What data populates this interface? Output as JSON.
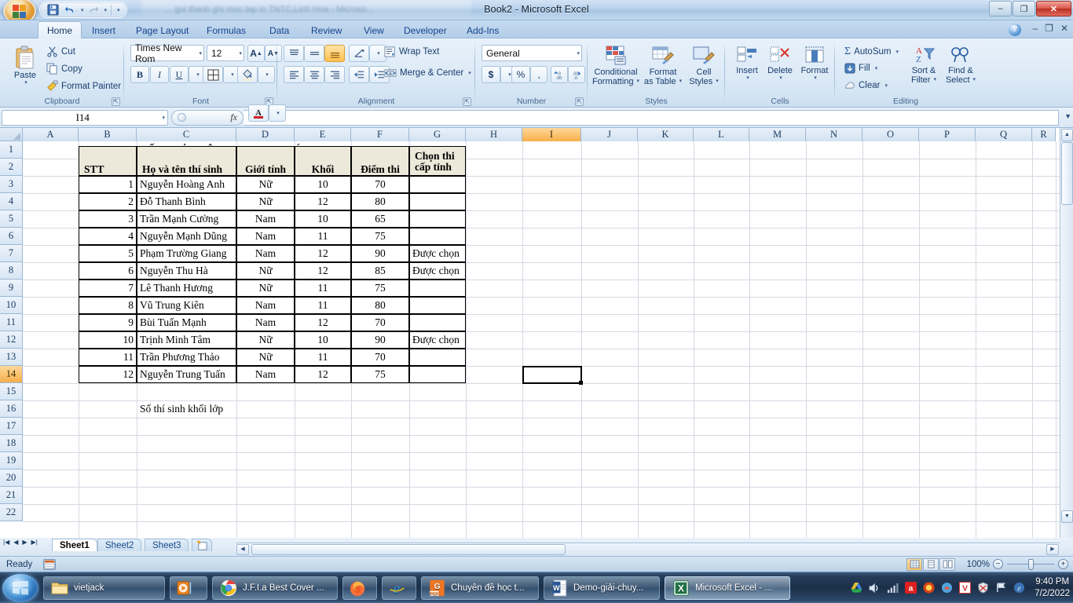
{
  "window": {
    "title": "Book2 - Microsoft Excel",
    "ghost_title": "... gui thanh ghi muc tap in TNTC,Linh Hoa - Microso...",
    "minimize": "–",
    "restore": "❐",
    "close": "✕",
    "help": "?",
    "ribbon_minimize": "–",
    "ribbon_restore": "❐",
    "ribbon_close": "✕"
  },
  "quick_access": {
    "save": "save-icon",
    "undo": "undo-icon",
    "redo": "redo-icon",
    "customize": "customize-icon"
  },
  "tabs": [
    {
      "label": "Home",
      "active": true
    },
    {
      "label": "Insert",
      "active": false
    },
    {
      "label": "Page Layout",
      "active": false
    },
    {
      "label": "Formulas",
      "active": false
    },
    {
      "label": "Data",
      "active": false
    },
    {
      "label": "Review",
      "active": false
    },
    {
      "label": "View",
      "active": false
    },
    {
      "label": "Developer",
      "active": false
    },
    {
      "label": "Add-Ins",
      "active": false
    }
  ],
  "ribbon": {
    "clipboard": {
      "group_label": "Clipboard",
      "paste": "Paste",
      "cut": "Cut",
      "copy": "Copy",
      "format_painter": "Format Painter"
    },
    "font": {
      "group_label": "Font",
      "font_name": "Times New Rom",
      "font_size": "12",
      "grow_font": "A",
      "shrink_font": "A",
      "bold": "B",
      "italic": "I",
      "underline": "U",
      "borders": "borders-icon",
      "fill_color": "fill-color-icon",
      "font_color": "A"
    },
    "alignment": {
      "group_label": "Alignment",
      "align_top": "align-top-icon",
      "align_middle": "align-middle-icon",
      "align_bottom": "align-bottom-icon",
      "orientation": "orientation-icon",
      "align_left": "align-left-icon",
      "align_center": "align-center-icon",
      "align_right": "align-right-icon",
      "decrease_indent": "decrease-indent-icon",
      "increase_indent": "increase-indent-icon",
      "wrap_text": "Wrap Text",
      "merge_center": "Merge & Center"
    },
    "number": {
      "group_label": "Number",
      "format": "General",
      "currency": "$",
      "percent": "%",
      "comma": ",",
      "increase_decimal": "increase-decimal-icon",
      "decrease_decimal": "decrease-decimal-icon"
    },
    "styles": {
      "group_label": "Styles",
      "conditional_formatting": "Conditional\nFormatting",
      "conditional_formatting_l1": "Conditional",
      "conditional_formatting_l2": "Formatting",
      "format_as_table_l1": "Format",
      "format_as_table_l2": "as Table",
      "cell_styles_l1": "Cell",
      "cell_styles_l2": "Styles"
    },
    "cells": {
      "group_label": "Cells",
      "insert": "Insert",
      "delete": "Delete",
      "format": "Format"
    },
    "editing": {
      "group_label": "Editing",
      "autosum": "AutoSum",
      "fill": "Fill",
      "clear": "Clear",
      "sort_filter_l1": "Sort &",
      "sort_filter_l2": "Filter",
      "find_select_l1": "Find &",
      "find_select_l2": "Select"
    }
  },
  "formula_bar": {
    "name_box": "I14",
    "fx_label": "fx",
    "formula_value": ""
  },
  "grid": {
    "columns": [
      "A",
      "B",
      "C",
      "D",
      "E",
      "F",
      "G",
      "H",
      "I",
      "J",
      "K",
      "L",
      "M",
      "N",
      "O",
      "P",
      "Q",
      "R"
    ],
    "selected_column": "I",
    "rows": [
      1,
      2,
      3,
      4,
      5,
      6,
      7,
      8,
      9,
      10,
      11,
      12,
      13,
      14,
      15,
      16,
      17,
      18,
      19,
      20,
      21,
      22
    ],
    "selected_row": 14,
    "selected_cell": "I14"
  },
  "sheet": {
    "title": "KẾT QUẢ CUỘC THI GIỌNG HÁT HAY",
    "headers": [
      "STT",
      "Họ và tên thí sinh",
      "Giới tính",
      "Khối",
      "Điểm thi",
      "Chọn thi cấp tỉnh"
    ],
    "headers_wrapped": [
      {
        "l1": "STT",
        "l2": ""
      },
      {
        "l1": "Họ và tên thí sinh",
        "l2": ""
      },
      {
        "l1": "Giới tính",
        "l2": ""
      },
      {
        "l1": "Khối",
        "l2": ""
      },
      {
        "l1": "Điểm thi",
        "l2": ""
      },
      {
        "l1": "Chọn thi",
        "l2": "cấp tỉnh"
      }
    ],
    "rows": [
      {
        "stt": "1",
        "name": "Nguyễn Hoàng Anh",
        "gender": "Nữ",
        "grade": "10",
        "score": "70",
        "selected": ""
      },
      {
        "stt": "2",
        "name": "Đỗ Thanh Bình",
        "gender": "Nữ",
        "grade": "12",
        "score": "80",
        "selected": ""
      },
      {
        "stt": "3",
        "name": "Trần Mạnh Cường",
        "gender": "Nam",
        "grade": "10",
        "score": "65",
        "selected": ""
      },
      {
        "stt": "4",
        "name": "Nguyễn Mạnh Dũng",
        "gender": "Nam",
        "grade": "11",
        "score": "75",
        "selected": ""
      },
      {
        "stt": "5",
        "name": "Phạm Trường Giang",
        "gender": "Nam",
        "grade": "12",
        "score": "90",
        "selected": "Được chọn"
      },
      {
        "stt": "6",
        "name": "Nguyễn Thu Hà",
        "gender": "Nữ",
        "grade": "12",
        "score": "85",
        "selected": "Được chọn"
      },
      {
        "stt": "7",
        "name": "Lê Thanh Hương",
        "gender": "Nữ",
        "grade": "11",
        "score": "75",
        "selected": ""
      },
      {
        "stt": "8",
        "name": "Vũ Trung Kiên",
        "gender": "Nam",
        "grade": "11",
        "score": "80",
        "selected": ""
      },
      {
        "stt": "9",
        "name": "Bùi Tuấn Mạnh",
        "gender": "Nam",
        "grade": "12",
        "score": "70",
        "selected": ""
      },
      {
        "stt": "10",
        "name": "Trịnh Minh Tâm",
        "gender": "Nữ",
        "grade": "10",
        "score": "90",
        "selected": "Được chọn"
      },
      {
        "stt": "11",
        "name": "Trần Phương Thảo",
        "gender": "Nữ",
        "grade": "11",
        "score": "70",
        "selected": ""
      },
      {
        "stt": "12",
        "name": "Nguyễn Trung Tuấn",
        "gender": "Nam",
        "grade": "12",
        "score": "75",
        "selected": ""
      }
    ],
    "footer_label": "Số thí sinh khối lớp"
  },
  "sheet_tabs": [
    {
      "label": "Sheet1",
      "active": true
    },
    {
      "label": "Sheet2",
      "active": false
    },
    {
      "label": "Sheet3",
      "active": false
    }
  ],
  "status": {
    "ready": "Ready",
    "zoom": "100%",
    "zoom_out": "−",
    "zoom_in": "+",
    "view_normal": "normal-view-icon",
    "view_page_layout": "page-layout-view-icon",
    "view_page_break": "page-break-view-icon"
  },
  "taskbar": {
    "start": "start-orb-icon",
    "buttons": [
      {
        "label": "vietjack",
        "icon": "folder-icon"
      },
      {
        "label": "",
        "icon": "media-player-icon"
      },
      {
        "label": "J.F.I.a Best Cover ...",
        "icon": "chrome-icon"
      },
      {
        "label": "",
        "icon": "firefox-icon"
      },
      {
        "label": "",
        "icon": "internet-explorer-icon"
      },
      {
        "label": "Chuyên đề học t...",
        "icon": "pdf-icon"
      },
      {
        "label": "Demo-giải-chuy...",
        "icon": "word-icon"
      },
      {
        "label": "Microsoft Excel - ...",
        "icon": "excel-icon"
      }
    ],
    "tray": [
      "google-drive-icon",
      "volume-icon",
      "network-icon",
      "avira-icon",
      "unikey-icon",
      "app-icon",
      "v-icon",
      "bkav-icon",
      "flag-icon",
      "ie-icon"
    ],
    "time": "9:40 PM",
    "date": "7/2/2022"
  },
  "colors": {
    "accent": "#15428b",
    "header_fill": "#ece9da",
    "selection": "#f6ae4a",
    "title_gradient": "#bcd3ec"
  }
}
